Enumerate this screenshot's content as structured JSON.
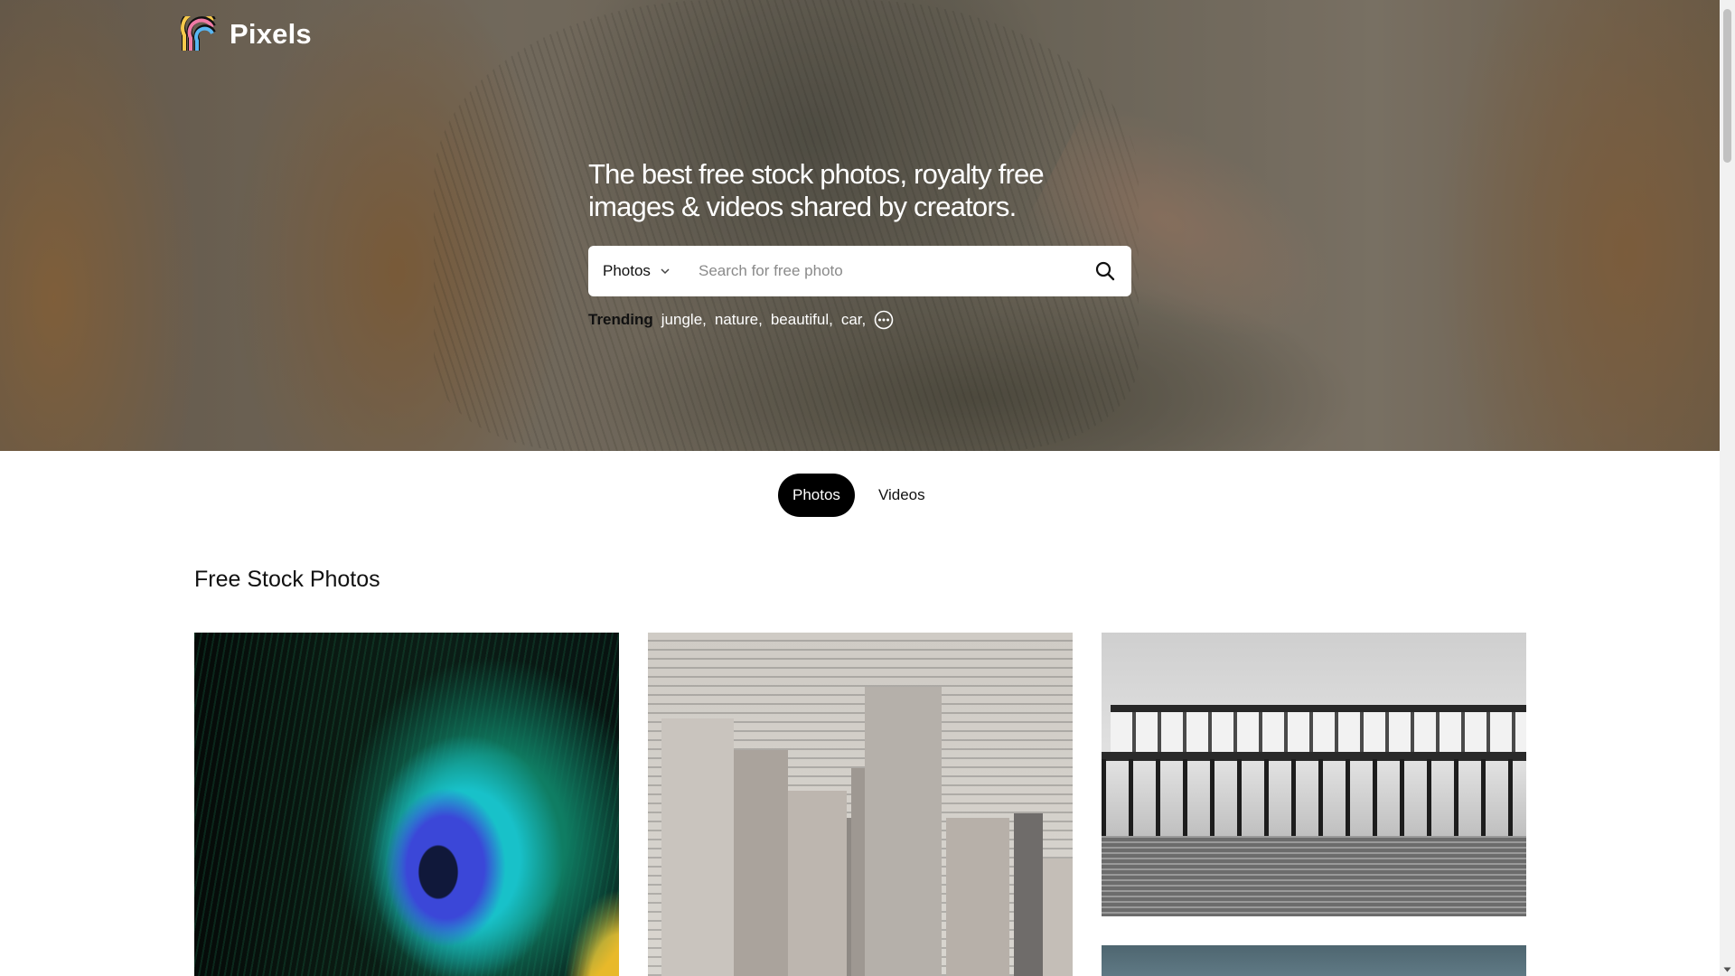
{
  "brand": {
    "name": "Pixels"
  },
  "hero": {
    "headline": "The best free stock photos, royalty free images & videos shared by creators.",
    "search": {
      "type_label": "Photos",
      "placeholder": "Search for free photo"
    },
    "trending": {
      "label": "Trending",
      "tags": [
        "jungle,",
        "nature,",
        "beautiful,",
        "car,"
      ]
    }
  },
  "toggle": {
    "photos_label": "Photos",
    "videos_label": "Videos",
    "active": "Photos"
  },
  "section": {
    "title": "Free Stock Photos"
  },
  "icons": {
    "search": "search-icon",
    "chevron": "chevron-down-icon",
    "more": "more-horizontal-icon",
    "logo": "rainbow-logo-icon"
  },
  "colors": {
    "toggle_active": "#000000",
    "hero_text": "#ffffff"
  }
}
